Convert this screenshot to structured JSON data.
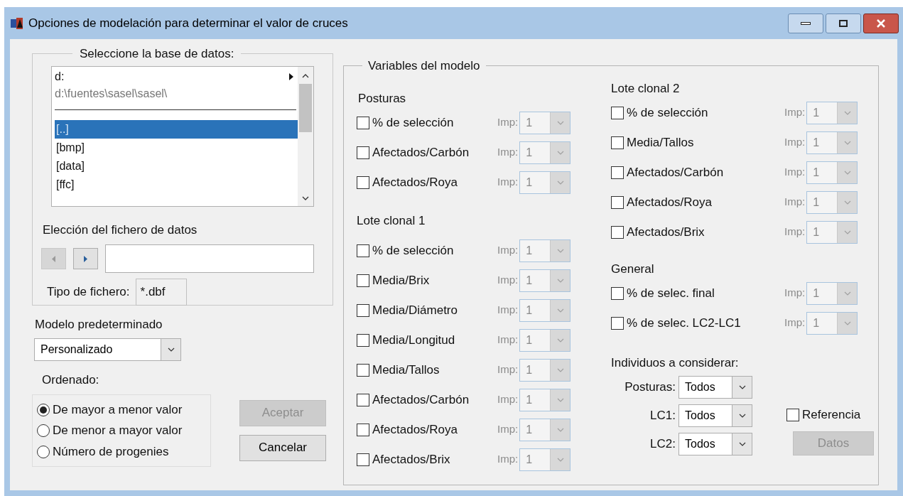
{
  "window": {
    "title": "Opciones de modelación para determinar el valor de cruces"
  },
  "database": {
    "legend": "Seleccione la base de datos:",
    "drive": "d:",
    "path": "d:\\fuentes\\sasel\\sasel\\",
    "folders": [
      {
        "label": "[..]",
        "selected": true
      },
      {
        "label": "[bmp]",
        "selected": false
      },
      {
        "label": "[data]",
        "selected": false
      },
      {
        "label": "[ffc]",
        "selected": false
      }
    ],
    "file_label": "Elección del fichero de datos",
    "type_label": "Tipo de fichero:",
    "type_value": "*.dbf"
  },
  "model": {
    "label": "Modelo predeterminado",
    "value": "Personalizado"
  },
  "order": {
    "label": "Ordenado:",
    "options": [
      {
        "label": "De mayor a menor valor",
        "selected": true
      },
      {
        "label": "De menor a mayor valor",
        "selected": false
      },
      {
        "label": "Número de progenies",
        "selected": false
      }
    ]
  },
  "buttons": [
    {
      "label": "Aceptar",
      "disabled": true
    },
    {
      "label": "Cancelar",
      "disabled": false
    }
  ],
  "variables": {
    "legend": "Variables del modelo",
    "columns": [
      [
        {
          "title": "Posturas",
          "items": [
            {
              "label": "% de selección",
              "checked": false,
              "imp_label": "Imp:",
              "imp_value": "1"
            },
            {
              "label": "Afectados/Carbón",
              "checked": false,
              "imp_label": "Imp:",
              "imp_value": "1"
            },
            {
              "label": "Afectados/Roya",
              "checked": false,
              "imp_label": "Imp:",
              "imp_value": "1"
            }
          ]
        },
        {
          "title": "Lote clonal 1",
          "items": [
            {
              "label": "% de selección",
              "checked": false,
              "imp_label": "Imp:",
              "imp_value": "1"
            },
            {
              "label": "Media/Brix",
              "checked": false,
              "imp_label": "Imp:",
              "imp_value": "1"
            },
            {
              "label": "Media/Diámetro",
              "checked": false,
              "imp_label": "Imp:",
              "imp_value": "1"
            },
            {
              "label": "Media/Longitud",
              "checked": false,
              "imp_label": "Imp:",
              "imp_value": "1"
            },
            {
              "label": "Media/Tallos",
              "checked": false,
              "imp_label": "Imp:",
              "imp_value": "1"
            },
            {
              "label": "Afectados/Carbón",
              "checked": false,
              "imp_label": "Imp:",
              "imp_value": "1"
            },
            {
              "label": "Afectados/Roya",
              "checked": false,
              "imp_label": "Imp:",
              "imp_value": "1"
            },
            {
              "label": "Afectados/Brix",
              "checked": false,
              "imp_label": "Imp:",
              "imp_value": "1"
            }
          ]
        }
      ],
      [
        {
          "title": "Lote clonal 2",
          "items": [
            {
              "label": "% de selección",
              "checked": false,
              "imp_label": "Imp:",
              "imp_value": "1"
            },
            {
              "label": "Media/Tallos",
              "checked": false,
              "imp_label": "Imp:",
              "imp_value": "1"
            },
            {
              "label": "Afectados/Carbón",
              "checked": false,
              "imp_label": "Imp:",
              "imp_value": "1"
            },
            {
              "label": "Afectados/Roya",
              "checked": false,
              "imp_label": "Imp:",
              "imp_value": "1"
            },
            {
              "label": "Afectados/Brix",
              "checked": false,
              "imp_label": "Imp:",
              "imp_value": "1"
            }
          ]
        },
        {
          "title": "General",
          "items": [
            {
              "label": "% de selec. final",
              "checked": false,
              "imp_label": "Imp:",
              "imp_value": "1"
            },
            {
              "label": "% de selec. LC2-LC1",
              "checked": false,
              "imp_label": "Imp:",
              "imp_value": "1"
            }
          ]
        }
      ]
    ]
  },
  "individuals": {
    "title": "Individuos a considerar:",
    "filters": [
      {
        "label": "Posturas:",
        "value": "Todos"
      },
      {
        "label": "LC1:",
        "value": "Todos"
      },
      {
        "label": "LC2:",
        "value": "Todos"
      }
    ],
    "reference": {
      "label": "Referencia",
      "checked": false
    },
    "data_button": {
      "label": "Datos",
      "disabled": true
    }
  }
}
